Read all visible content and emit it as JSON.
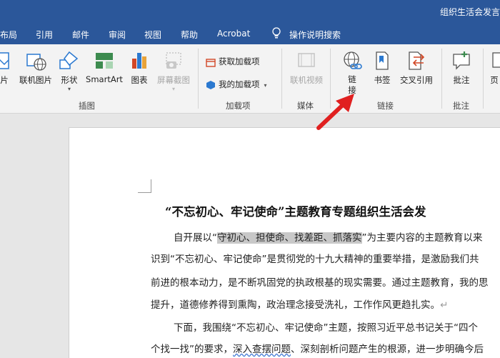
{
  "window": {
    "title": "组织生活会发言"
  },
  "menu": {
    "tabs": [
      "布局",
      "引用",
      "邮件",
      "审阅",
      "视图",
      "帮助",
      "Acrobat"
    ],
    "tell_me": "操作说明搜索"
  },
  "ribbon": {
    "illustrations": {
      "picture_partial": "片",
      "online_picture": "联机图片",
      "shapes": "形状",
      "smartart": "SmartArt",
      "chart": "图表",
      "screenshot": "屏幕截图",
      "group_label": "插图"
    },
    "addins": {
      "get_addins": "获取加载项",
      "my_addins": "我的加载项",
      "group_label": "加载项"
    },
    "media": {
      "online_video": "联机视频",
      "group_label": "媒体"
    },
    "links": {
      "link_line1": "链",
      "link_line2": "接",
      "bookmark": "书签",
      "cross_ref": "交叉引用",
      "group_label": "链接"
    },
    "comments": {
      "comment": "批注",
      "group_label": "批注"
    },
    "header_partial": "页"
  },
  "document": {
    "heading": "“不忘初心、牢记使命”主题教育专题组织生活会发",
    "para1_lead": "自开展以“",
    "para1_highlight": "守初心、担使命、找差距、抓落实",
    "para1_tail": "”为主要内容的主题教育以来",
    "line2": "识到“不忘初心、牢记使命”是贯彻党的十九大精神的重要举措，是激励我们共",
    "line3": "前进的根本动力，是不断巩固党的执政根基的现实需要。通过主题教育，我的思",
    "line4": "提升，道德修养得到熏陶，政治理念接受洗礼，工作作风更趋扎实。",
    "para_mark": "↵",
    "line5": "下面，我围绕“不忘初心、牢记使命”主题，按照习近平总书记关于“四个",
    "line6_lead": "个找一找”的要求，",
    "line6_squiggle": "深入查摆问题",
    "line6_tail": "、深刻剖析问题产生的根源，进一步明确今后"
  },
  "colors": {
    "title_bar": "#2b579a",
    "ribbon_bg": "#f3f3f3",
    "arrow": "#e02020"
  }
}
